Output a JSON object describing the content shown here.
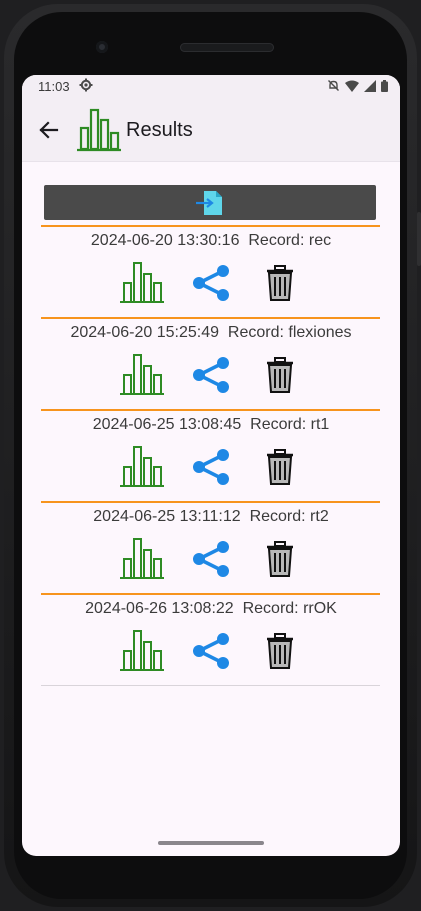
{
  "status": {
    "time": "11:03"
  },
  "header": {
    "title": "Results"
  },
  "records": [
    {
      "timestamp": "2024-06-20 13:30:16",
      "record_prefix": "Record:",
      "name": "rec"
    },
    {
      "timestamp": "2024-06-20 15:25:49",
      "record_prefix": "Record:",
      "name": "flexiones"
    },
    {
      "timestamp": "2024-06-25 13:08:45",
      "record_prefix": "Record:",
      "name": "rt1"
    },
    {
      "timestamp": "2024-06-25 13:11:12",
      "record_prefix": "Record:",
      "name": "rt2"
    },
    {
      "timestamp": "2024-06-26 13:08:22",
      "record_prefix": "Record:",
      "name": "rrOK"
    }
  ],
  "colors": {
    "separator": "#f7941d",
    "chart_icon": "#2e8b24",
    "share_icon": "#1e88e5",
    "import_button": "#4a4a4a"
  },
  "icons": {
    "back": "arrow-left-icon",
    "chart": "bar-chart-icon",
    "share": "share-icon",
    "delete": "trash-icon",
    "import": "file-import-icon"
  }
}
